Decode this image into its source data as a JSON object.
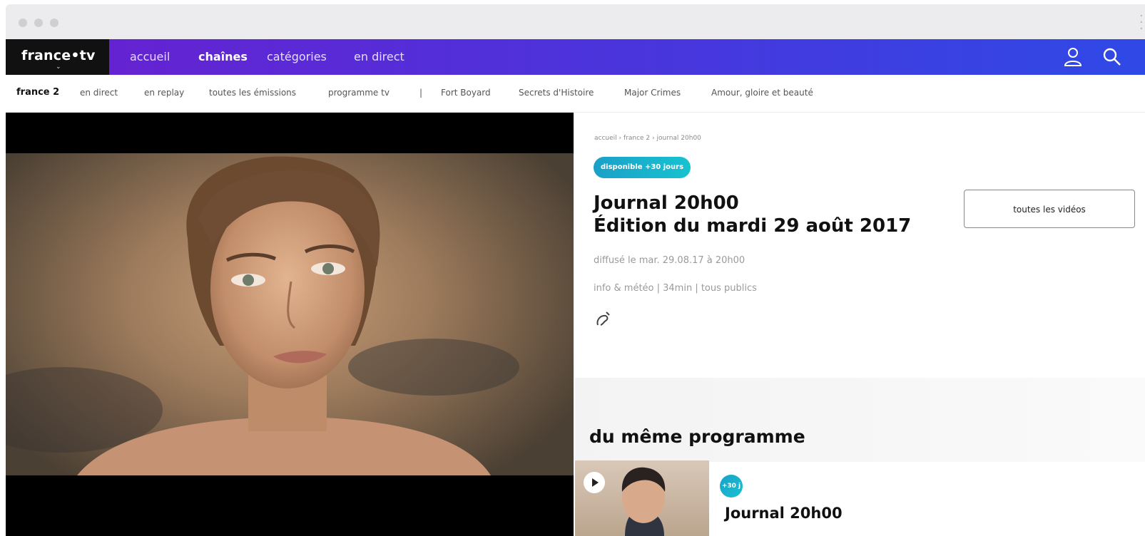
{
  "topnav": {
    "brand": "france•tv",
    "links": [
      "accueil",
      "chaînes",
      "catégories",
      "en direct"
    ],
    "active_link": "chaînes"
  },
  "subnav": {
    "channel": "france 2",
    "items": [
      "en direct",
      "en replay",
      "toutes les émissions",
      "programme tv"
    ],
    "separator": "|",
    "shows": [
      "Fort Boyard",
      "Secrets d'Histoire",
      "Major Crimes",
      "Amour, gloire et beauté"
    ]
  },
  "breadcrumb": "accueil › france 2 › journal 20h00",
  "program": {
    "badge": "disponible +30 jours",
    "title_line1": "Journal 20h00",
    "title_line2": "Édition du mardi 29 août 2017",
    "broadcast": "diffusé le mar. 29.08.17 à 20h00",
    "info": "info & météo | 34min | tous publics",
    "all_videos_label": "toutes les vidéos"
  },
  "related": {
    "section_title": "du même programme",
    "badge": "+30 j",
    "item_title": "Journal 20h00"
  },
  "colors": {
    "nav_gradient_start": "#6a1fd0",
    "nav_gradient_end": "#2f49e6",
    "badge": "#18b4cc"
  },
  "icons": [
    "user-icon",
    "search-icon",
    "audio-description-icon",
    "play-icon"
  ]
}
